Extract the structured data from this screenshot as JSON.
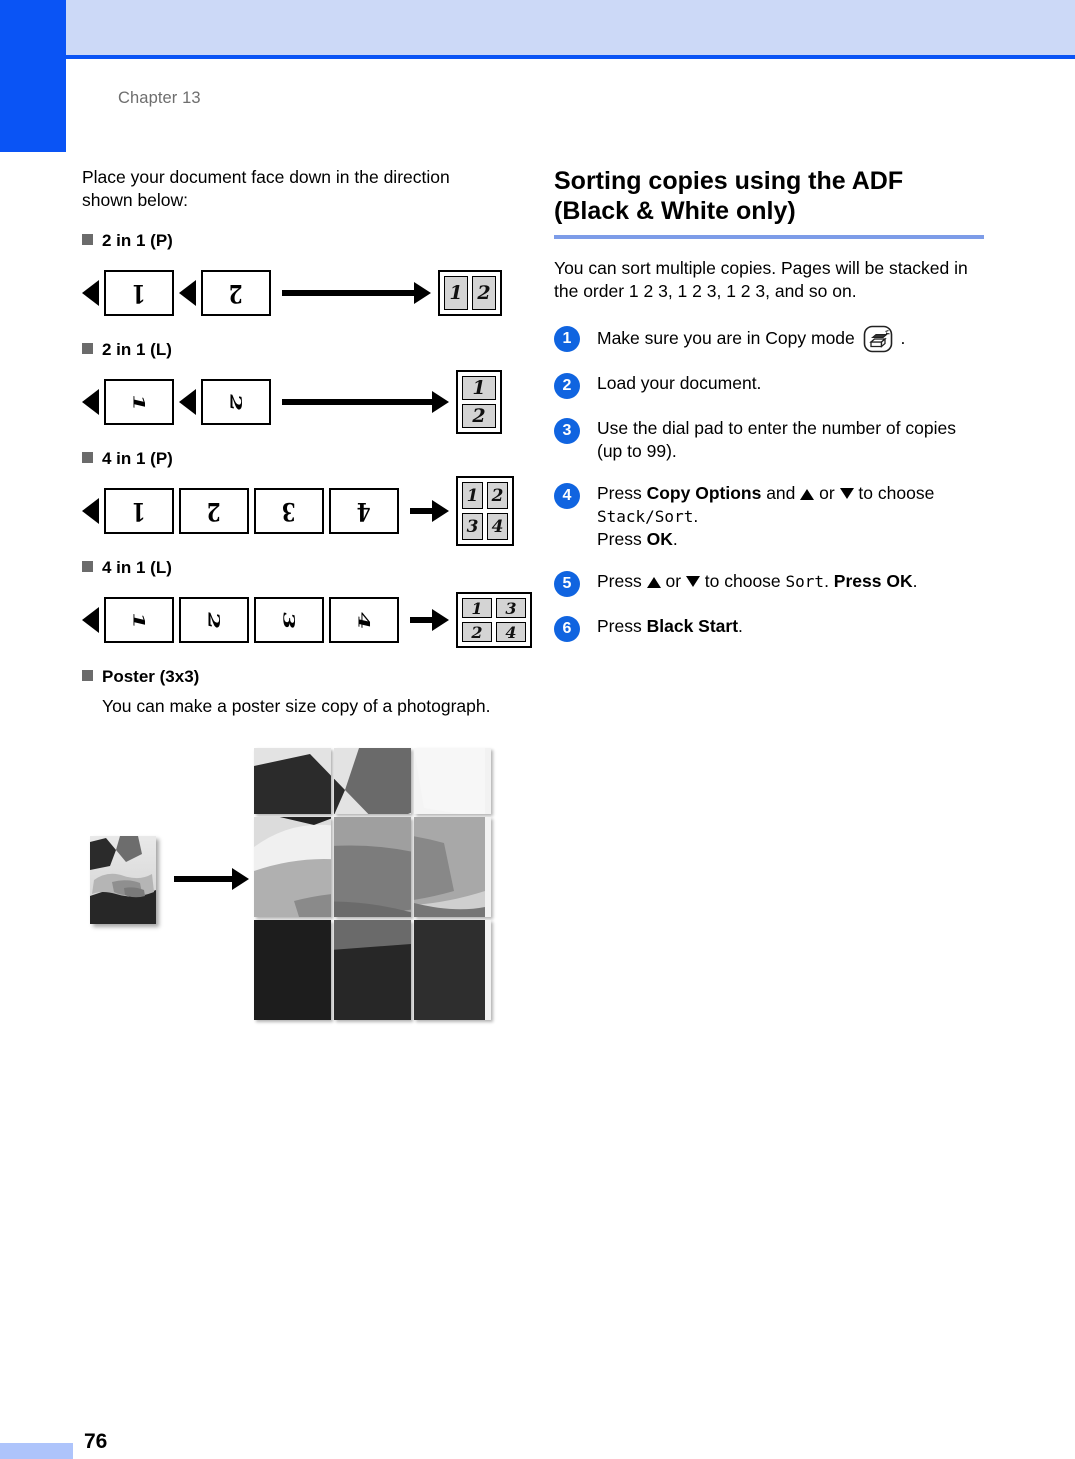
{
  "page": {
    "chapter_label": "Chapter 13",
    "page_number": "76",
    "accent_blue": "#0a54f5",
    "band_blue": "#ccd9f7",
    "footer_bar_blue": "#aec4fb",
    "rule_blue": "#7d9ce8",
    "step_circle_blue": "#1064e0"
  },
  "left_column": {
    "intro": "Place your document face down in the direction shown below:",
    "layouts": [
      {
        "label": "2 in 1 (P)",
        "result_cells": [
          "1",
          "2"
        ],
        "result_kind": "two-h",
        "pages": 2
      },
      {
        "label": "2 in 1 (L)",
        "result_cells": [
          "1",
          "2"
        ],
        "result_kind": "two-v",
        "pages": 2
      },
      {
        "label": "4 in 1 (P)",
        "result_cells": [
          "1",
          "2",
          "3",
          "4"
        ],
        "result_kind": "four-p",
        "pages": 4
      },
      {
        "label": "4 in 1 (L)",
        "result_cells": [
          "1",
          "3",
          "2",
          "4"
        ],
        "result_kind": "four-l",
        "pages": 4
      }
    ],
    "poster": {
      "label": "Poster (3x3)",
      "description": "You can make a poster size copy of a photograph.",
      "image_alt": "handshake-photograph"
    }
  },
  "right_column": {
    "section_title_line1": "Sorting copies using the ADF",
    "section_title_line2": "(Black & White only)",
    "intro": "You can sort multiple copies. Pages will be stacked in the order 1 2 3, 1 2 3, 1 2 3, and so on.",
    "steps": [
      {
        "number": "1",
        "parts": [
          {
            "t": "text",
            "v": "Make sure you are in Copy mode "
          },
          {
            "t": "icon",
            "v": "copy-mode-icon"
          },
          {
            "t": "text",
            "v": " ."
          }
        ]
      },
      {
        "number": "2",
        "parts": [
          {
            "t": "text",
            "v": "Load your document."
          }
        ]
      },
      {
        "number": "3",
        "parts": [
          {
            "t": "text",
            "v": "Use the dial pad to enter the number of copies (up to 99)."
          }
        ]
      },
      {
        "number": "4",
        "parts": [
          {
            "t": "text",
            "v": "Press "
          },
          {
            "t": "bold",
            "v": "Copy Options"
          },
          {
            "t": "text",
            "v": " and "
          },
          {
            "t": "icon",
            "v": "triangle-up-icon"
          },
          {
            "t": "text",
            "v": " or "
          },
          {
            "t": "icon",
            "v": "triangle-down-icon"
          },
          {
            "t": "text",
            "v": " to choose "
          },
          {
            "t": "mono",
            "v": "Stack/Sort"
          },
          {
            "t": "text",
            "v": "."
          },
          {
            "t": "br",
            "v": ""
          },
          {
            "t": "text",
            "v": "Press "
          },
          {
            "t": "bold",
            "v": "OK"
          },
          {
            "t": "text",
            "v": "."
          }
        ]
      },
      {
        "number": "5",
        "parts": [
          {
            "t": "text",
            "v": "Press "
          },
          {
            "t": "icon",
            "v": "triangle-up-icon"
          },
          {
            "t": "text",
            "v": " or "
          },
          {
            "t": "icon",
            "v": "triangle-down-icon"
          },
          {
            "t": "text",
            "v": " to choose "
          },
          {
            "t": "mono",
            "v": "Sort"
          },
          {
            "t": "text",
            "v": ". "
          },
          {
            "t": "bold",
            "v": "Press OK"
          },
          {
            "t": "text",
            "v": "."
          }
        ]
      },
      {
        "number": "6",
        "parts": [
          {
            "t": "text",
            "v": "Press "
          },
          {
            "t": "bold",
            "v": "Black Start"
          },
          {
            "t": "text",
            "v": "."
          }
        ]
      }
    ]
  }
}
